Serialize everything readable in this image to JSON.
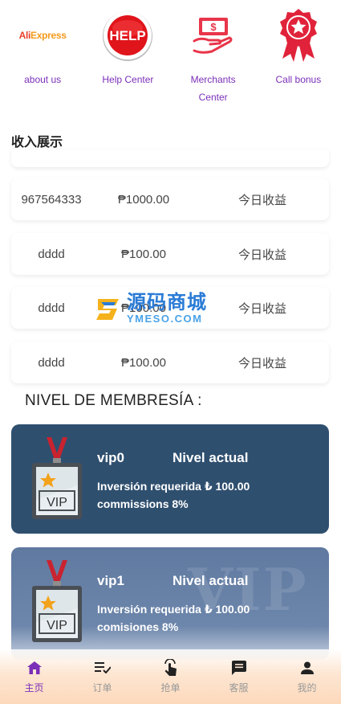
{
  "top_icons": [
    {
      "label": "about us",
      "icon": "aliexpress-logo",
      "logo_text_a": "Ali",
      "logo_text_b": "Express"
    },
    {
      "label": "Help Center",
      "icon": "help-button-icon",
      "logo_text": "HELP"
    },
    {
      "label": "Merchants Center",
      "icon": "money-hand-icon",
      "logo_text": "$"
    },
    {
      "label": "Call bonus",
      "icon": "award-ribbon-icon"
    }
  ],
  "income_section": {
    "title": "收入展示",
    "rows": [
      {
        "user": "967564333",
        "amount": "₱1000.00",
        "label": "今日收益"
      },
      {
        "user": "dddd",
        "amount": "₱100.00",
        "label": "今日收益"
      },
      {
        "user": "dddd",
        "amount": "₱100.00",
        "label": "今日收益"
      },
      {
        "user": "dddd",
        "amount": "₱100.00",
        "label": "今日收益"
      }
    ]
  },
  "watermark": {
    "cn": "源码商城",
    "en": "YMESO.COM"
  },
  "membership": {
    "title": "NIVEL DE MEMBRESÍA :",
    "cards": [
      {
        "name": "vip0",
        "status": "Nivel actual",
        "line1": "Inversión requerida ₺ 100.00",
        "line2": "commissions 8%",
        "badge_text": "VIP"
      },
      {
        "name": "vip1",
        "status": "Nivel actual",
        "line1": "Inversión requerida ₺ 100.00",
        "line2": "comisiones 8%",
        "badge_text": "VIP",
        "bg_text": "VIP"
      }
    ]
  },
  "bottom_nav": [
    {
      "label": "主页",
      "icon": "home-icon",
      "active": true
    },
    {
      "label": "订单",
      "icon": "order-list-icon",
      "active": false
    },
    {
      "label": "抢单",
      "icon": "tap-hand-icon",
      "active": false
    },
    {
      "label": "客服",
      "icon": "chat-icon",
      "active": false
    },
    {
      "label": "我的",
      "icon": "user-icon",
      "active": false
    }
  ],
  "colors": {
    "accent": "#7b2fb8",
    "card_dark": "#2f4f6f",
    "card_light": "#6d86ab",
    "help_red": "#e0141b"
  }
}
